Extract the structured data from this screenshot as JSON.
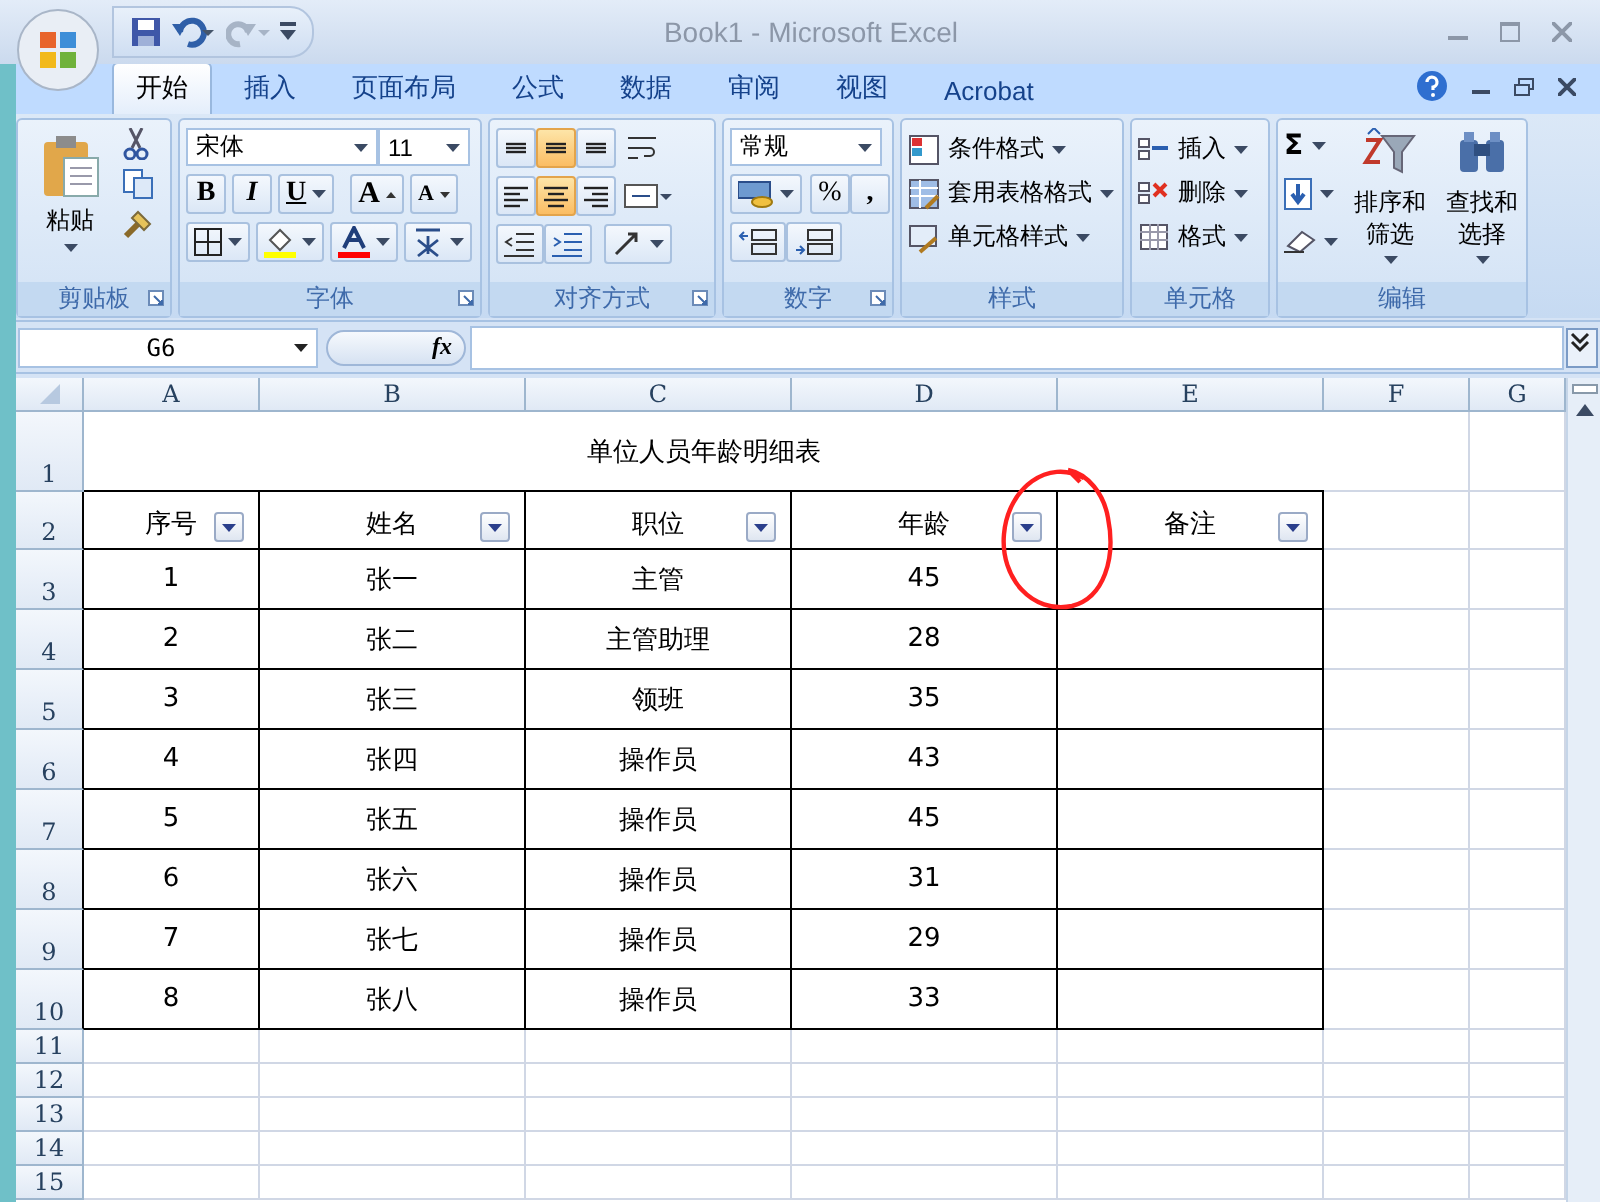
{
  "window": {
    "title": "Book1 - Microsoft Excel"
  },
  "tabs": [
    {
      "label": "开始",
      "selected": true
    },
    {
      "label": "插入",
      "selected": false
    },
    {
      "label": "页面布局",
      "selected": false
    },
    {
      "label": "公式",
      "selected": false
    },
    {
      "label": "数据",
      "selected": false
    },
    {
      "label": "审阅",
      "selected": false
    },
    {
      "label": "视图",
      "selected": false
    },
    {
      "label": "Acrobat",
      "selected": false
    }
  ],
  "ribbon": {
    "clipboard": {
      "label": "剪贴板",
      "paste": "粘贴"
    },
    "font": {
      "label": "字体",
      "name": "宋体",
      "size": "11",
      "bold": "B",
      "italic": "I",
      "underline": "U",
      "grow": "A",
      "shrink": "A"
    },
    "alignment": {
      "label": "对齐方式",
      "buttons": [
        {
          "kind": "top",
          "selected": false
        },
        {
          "kind": "middle",
          "selected": true
        },
        {
          "kind": "bottom",
          "selected": false
        },
        {
          "kind": "left",
          "selected": false
        },
        {
          "kind": "center",
          "selected": true
        },
        {
          "kind": "right",
          "selected": false
        }
      ]
    },
    "number": {
      "label": "数字",
      "format": "常规",
      "percent": "%",
      "comma": ","
    },
    "styles": {
      "label": "样式",
      "items": [
        "条件格式",
        "套用表格格式",
        "单元格样式"
      ]
    },
    "cells": {
      "label": "单元格",
      "items": [
        "插入",
        "删除",
        "格式"
      ]
    },
    "editing": {
      "label": "编辑",
      "sum": "Σ",
      "items": [
        "排序和筛选",
        "查找和选择"
      ]
    }
  },
  "formula_bar": {
    "name_box": "G6",
    "fx": "fx"
  },
  "sheet": {
    "columns": [
      "A",
      "B",
      "C",
      "D",
      "E",
      "F",
      "G"
    ],
    "row_numbers": [
      "1",
      "2",
      "3",
      "4",
      "5",
      "6",
      "7",
      "8",
      "9",
      "10",
      "11",
      "12",
      "13",
      "14",
      "15"
    ],
    "title": "单位人员年龄明细表",
    "header": [
      {
        "text": "序号",
        "filter": true
      },
      {
        "text": "姓名",
        "filter": true
      },
      {
        "text": "职位",
        "filter": true
      },
      {
        "text": "年龄",
        "filter": true
      },
      {
        "text": "备注",
        "filter": true
      }
    ],
    "records": [
      [
        "1",
        "张一",
        "主管",
        "45"
      ],
      [
        "2",
        "张二",
        "主管助理",
        "28"
      ],
      [
        "3",
        "张三",
        "领班",
        "35"
      ],
      [
        "4",
        "张四",
        "操作员",
        "43"
      ],
      [
        "5",
        "张五",
        "操作员",
        "45"
      ],
      [
        "6",
        "张六",
        "操作员",
        "31"
      ],
      [
        "7",
        "张七",
        "操作员",
        "29"
      ],
      [
        "8",
        "张八",
        "操作员",
        "33"
      ]
    ]
  }
}
